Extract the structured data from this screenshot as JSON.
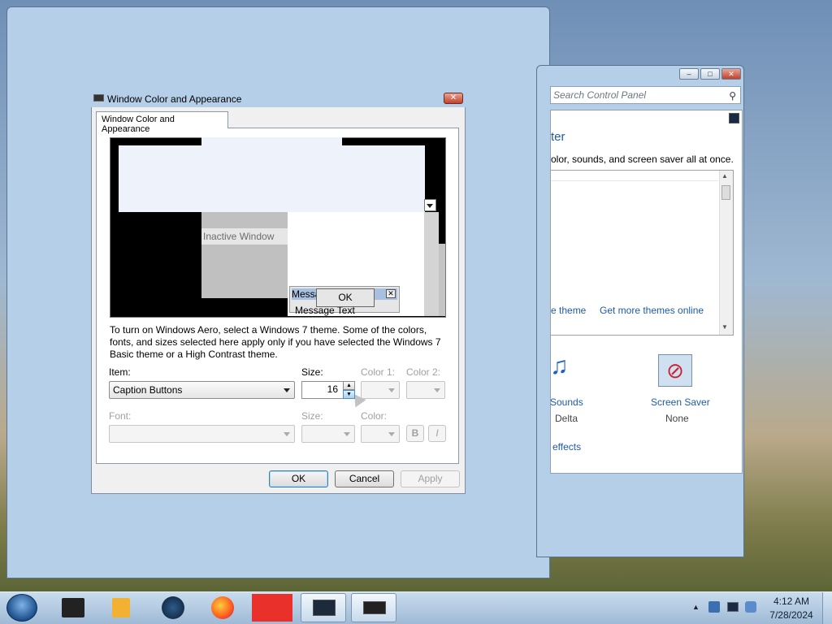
{
  "dialog": {
    "title": "Window Color and Appearance",
    "tab": "Window Color and Appearance",
    "preview": {
      "inactive_window": "Inactive Window",
      "message_box_title": "Message Box",
      "message_text": "Message Text",
      "ok": "OK"
    },
    "description": "To turn on Windows Aero, select a Windows 7 theme.  Some of the colors, fonts, and sizes selected here apply only if you have selected the Windows 7 Basic theme or a High Contrast theme.",
    "item_label": "Item:",
    "item_value": "Caption Buttons",
    "size_label": "Size:",
    "size_value": "16",
    "color1_label": "Color 1:",
    "color2_label": "Color 2:",
    "font_label": "Font:",
    "font_size_label": "Size:",
    "font_color_label": "Color:",
    "bold": "B",
    "italic": "I",
    "ok": "OK",
    "cancel": "Cancel",
    "apply": "Apply"
  },
  "control_panel": {
    "search_placeholder": "Search Control Panel",
    "heading_fragment": "ter",
    "description_fragment": "olor, sounds, and screen saver all at once.",
    "link_theme": "e theme",
    "link_more_themes": "Get more themes online",
    "sounds_label": "Sounds",
    "sounds_value": "Delta",
    "screensaver_label": "Screen Saver",
    "screensaver_value": "None",
    "effects_link": "effects"
  },
  "taskbar": {
    "time": "4:12 AM",
    "date": "7/28/2024"
  },
  "colors": {
    "selected_title": "#a8c0e0",
    "link": "#1e5aa8"
  }
}
